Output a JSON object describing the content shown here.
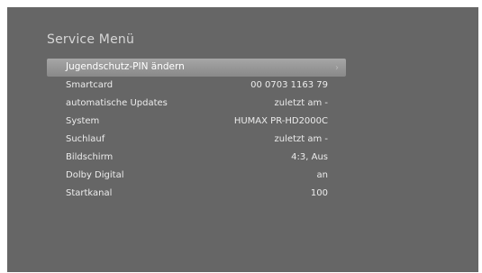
{
  "menu": {
    "title": "Service Menü",
    "items": [
      {
        "label": "Jugendschutz-PIN ändern",
        "value": "",
        "selected": true
      },
      {
        "label": "Smartcard",
        "value": "00 0703 1163 79"
      },
      {
        "label": "automatische Updates",
        "value": "zuletzt am -"
      },
      {
        "label": "System",
        "value": "HUMAX PR-HD2000C"
      },
      {
        "label": "Suchlauf",
        "value": "zuletzt am -"
      },
      {
        "label": "Bildschirm",
        "value": "4:3, Aus"
      },
      {
        "label": "Dolby Digital",
        "value": "an"
      },
      {
        "label": "Startkanal",
        "value": "100"
      }
    ]
  },
  "icons": {
    "selected_row_arrow": "chevron-right-icon"
  }
}
